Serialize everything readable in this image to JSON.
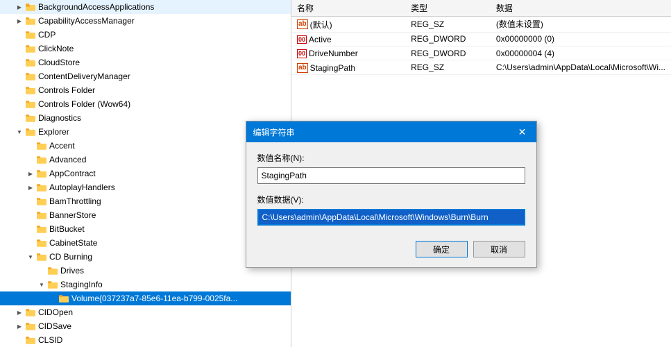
{
  "tree": {
    "items": [
      {
        "id": "BackgroundAccessApplications",
        "label": "BackgroundAccessApplications",
        "indent": 1,
        "toggle": "collapsed",
        "selected": false
      },
      {
        "id": "CapabilityAccessManager",
        "label": "CapabilityAccessManager",
        "indent": 1,
        "toggle": "collapsed",
        "selected": false
      },
      {
        "id": "CDP",
        "label": "CDP",
        "indent": 1,
        "toggle": "empty",
        "selected": false
      },
      {
        "id": "ClickNote",
        "label": "ClickNote",
        "indent": 1,
        "toggle": "empty",
        "selected": false
      },
      {
        "id": "CloudStore",
        "label": "CloudStore",
        "indent": 1,
        "toggle": "empty",
        "selected": false
      },
      {
        "id": "ContentDeliveryManager",
        "label": "ContentDeliveryManager",
        "indent": 1,
        "toggle": "empty",
        "selected": false
      },
      {
        "id": "Controls Folder",
        "label": "Controls Folder",
        "indent": 1,
        "toggle": "empty",
        "selected": false
      },
      {
        "id": "Controls Folder Wow64",
        "label": "Controls Folder (Wow64)",
        "indent": 1,
        "toggle": "empty",
        "selected": false
      },
      {
        "id": "Diagnostics",
        "label": "Diagnostics",
        "indent": 1,
        "toggle": "empty",
        "selected": false
      },
      {
        "id": "Explorer",
        "label": "Explorer",
        "indent": 1,
        "toggle": "expanded",
        "selected": false
      },
      {
        "id": "Accent",
        "label": "Accent",
        "indent": 2,
        "toggle": "empty",
        "selected": false
      },
      {
        "id": "Advanced",
        "label": "Advanced",
        "indent": 2,
        "toggle": "empty",
        "selected": false
      },
      {
        "id": "AppContract",
        "label": "AppContract",
        "indent": 2,
        "toggle": "collapsed",
        "selected": false
      },
      {
        "id": "AutoplayHandlers",
        "label": "AutoplayHandlers",
        "indent": 2,
        "toggle": "collapsed",
        "selected": false
      },
      {
        "id": "BamThrottling",
        "label": "BamThrottling",
        "indent": 2,
        "toggle": "empty",
        "selected": false
      },
      {
        "id": "BannerStore",
        "label": "BannerStore",
        "indent": 2,
        "toggle": "empty",
        "selected": false
      },
      {
        "id": "BitBucket",
        "label": "BitBucket",
        "indent": 2,
        "toggle": "empty",
        "selected": false
      },
      {
        "id": "CabinetState",
        "label": "CabinetState",
        "indent": 2,
        "toggle": "empty",
        "selected": false
      },
      {
        "id": "CD Burning",
        "label": "CD Burning",
        "indent": 2,
        "toggle": "expanded",
        "selected": false
      },
      {
        "id": "Drives",
        "label": "Drives",
        "indent": 3,
        "toggle": "empty",
        "selected": false
      },
      {
        "id": "StagingInfo",
        "label": "StagingInfo",
        "indent": 3,
        "toggle": "expanded",
        "selected": false
      },
      {
        "id": "Volume037",
        "label": "Volume{037237a7-85e6-11ea-b799-0025fa...",
        "indent": 4,
        "toggle": "empty",
        "selected": true
      },
      {
        "id": "CIDOpen",
        "label": "CIDOpen",
        "indent": 1,
        "toggle": "collapsed",
        "selected": false
      },
      {
        "id": "CIDSave",
        "label": "CIDSave",
        "indent": 1,
        "toggle": "collapsed",
        "selected": false
      },
      {
        "id": "CLSID",
        "label": "CLSID",
        "indent": 1,
        "toggle": "empty",
        "selected": false
      }
    ]
  },
  "registry_table": {
    "columns": [
      "名称",
      "类型",
      "数据"
    ],
    "rows": [
      {
        "icon": "ab",
        "icon_color": "#d04000",
        "name": "(默认)",
        "type": "REG_SZ",
        "data": "(数值未设置)"
      },
      {
        "icon": "dword",
        "icon_color": "#cc0000",
        "name": "Active",
        "type": "REG_DWORD",
        "data": "0x00000000 (0)",
        "selected": true
      },
      {
        "icon": "dword",
        "icon_color": "#cc0000",
        "name": "DriveNumber",
        "type": "REG_DWORD",
        "data": "0x00000004 (4)"
      },
      {
        "icon": "ab",
        "icon_color": "#d04000",
        "name": "StagingPath",
        "type": "REG_SZ",
        "data": "C:\\Users\\admin\\AppData\\Local\\Microsoft\\Wi..."
      }
    ]
  },
  "dialog": {
    "title": "编辑字符串",
    "close_label": "✕",
    "name_label": "数值名称(N):",
    "name_value": "StagingPath",
    "data_label": "数值数据(V):",
    "data_value": "C:\\Users\\admin\\AppData\\Local\\Microsoft\\Windows\\Burn\\Burn",
    "ok_label": "确定",
    "cancel_label": "取消"
  }
}
